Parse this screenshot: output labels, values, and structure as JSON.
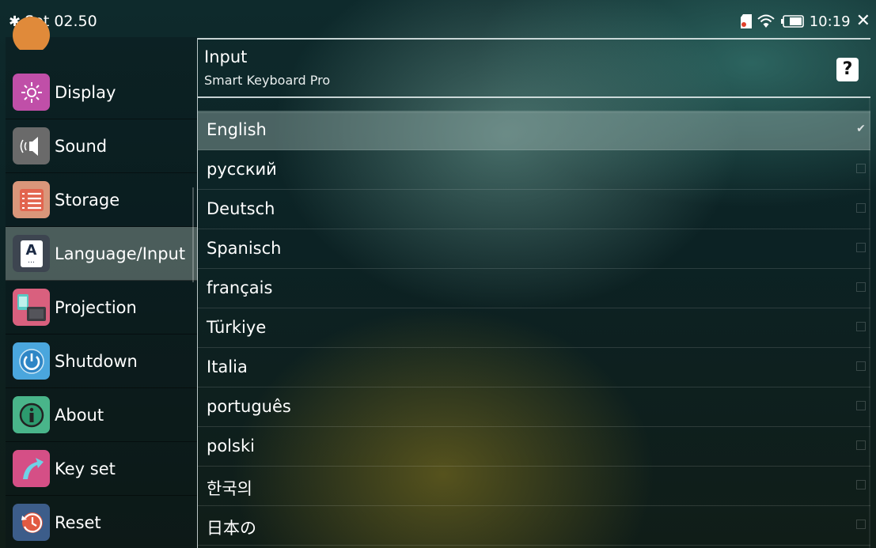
{
  "statusbar": {
    "app_title": "Set 02.50",
    "time": "10:19",
    "icons": [
      "gear-icon",
      "sd-card-icon",
      "wifi-icon",
      "battery-icon",
      "close-icon"
    ]
  },
  "sidebar": {
    "items": [
      {
        "label": "Display",
        "icon": "display-icon"
      },
      {
        "label": "Sound",
        "icon": "sound-icon"
      },
      {
        "label": "Storage",
        "icon": "storage-icon"
      },
      {
        "label": "Language/Input",
        "icon": "language-icon",
        "active": true
      },
      {
        "label": "Projection",
        "icon": "projection-icon"
      },
      {
        "label": "Shutdown",
        "icon": "shutdown-icon"
      },
      {
        "label": "About",
        "icon": "about-icon"
      },
      {
        "label": "Key set",
        "icon": "key-set-icon"
      },
      {
        "label": "Reset",
        "icon": "reset-icon"
      }
    ]
  },
  "panel": {
    "title": "Input",
    "subtitle": "Smart Keyboard Pro",
    "help_label": "?",
    "languages": [
      {
        "label": "English",
        "checked": true
      },
      {
        "label": "русский",
        "checked": false
      },
      {
        "label": "Deutsch",
        "checked": false
      },
      {
        "label": "Spanisch",
        "checked": false
      },
      {
        "label": "français",
        "checked": false
      },
      {
        "label": "Türkiye",
        "checked": false
      },
      {
        "label": "Italia",
        "checked": false
      },
      {
        "label": "português",
        "checked": false
      },
      {
        "label": "polski",
        "checked": false
      },
      {
        "label": "한국의",
        "checked": false
      },
      {
        "label": "日本の",
        "checked": false
      }
    ]
  },
  "colors": {
    "active_item_bg": "#8a9691",
    "selected_row_bg": "#8fb0aa",
    "help_button_bg": "#ffffff"
  }
}
